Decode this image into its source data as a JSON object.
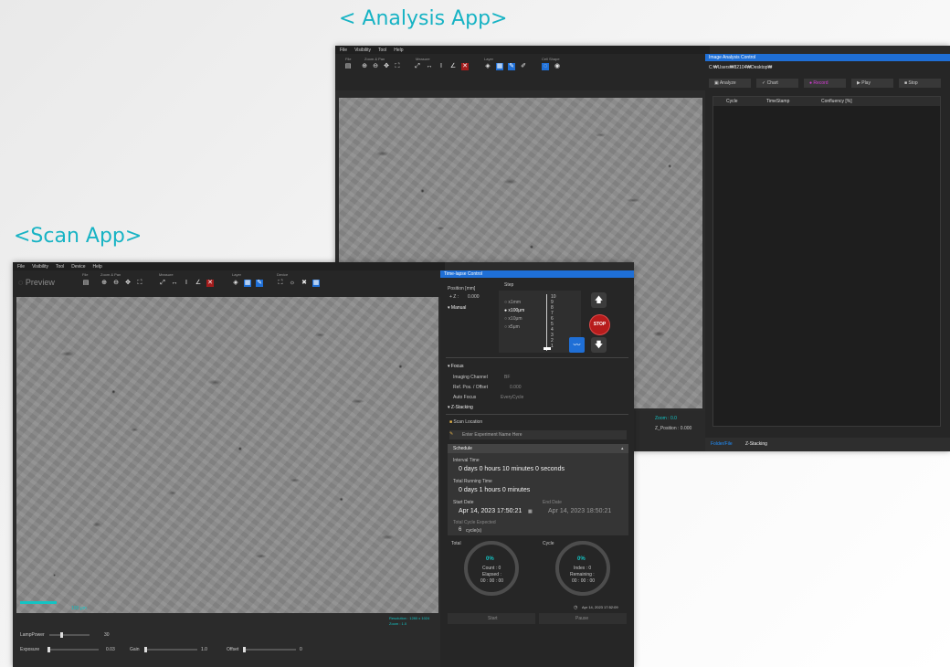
{
  "captions": {
    "analysis": "< Analysis App>",
    "scan": "<Scan App>"
  },
  "colors": {
    "accent": "#1f6fd6",
    "caption": "#17b3c4",
    "progress": "#13c3c3",
    "stop": "#b71c1c"
  },
  "analysis_app": {
    "menu": [
      "File",
      "Visibility",
      "Tool",
      "Help"
    ],
    "toolbar_groups": [
      "File",
      "Zoom & Pan",
      "Measure",
      "Layer",
      "Cell Shape"
    ],
    "panel": {
      "title": "Image Analysis Control",
      "path": "C:₩Users₩82104₩Desktop₩",
      "buttons": [
        "Analyze",
        "Chart",
        "Record",
        "Play",
        "Stop"
      ],
      "columns": [
        "Cycle",
        "TimeStamp",
        "Confluency [%]"
      ],
      "bottom_tabs": [
        "Folder/File",
        "Z-Stacking"
      ]
    },
    "status": {
      "z_position": "Z_Position : 0.000",
      "zoom": "Zoom : 0.0"
    }
  },
  "scan_app": {
    "menu": [
      "File",
      "Visibility",
      "Tool",
      "Device",
      "Help"
    ],
    "preview_label": "Preview",
    "toolbar_groups": [
      "File",
      "Zoom & Pan",
      "Measure",
      "Layer",
      "Device"
    ],
    "viewer": {
      "resolution": "Resolution : 1280 x 1024",
      "zoom": "Zoom : 1.0",
      "scale": "100 μm"
    },
    "controls": {
      "lamp_power_label": "LampPower",
      "lamp_power_value": "30",
      "exposure_label": "Exposure",
      "exposure_value": "0.03",
      "gain_label": "Gain",
      "gain_value": "1.0",
      "offset_label": "Offset",
      "offset_value": "0"
    },
    "timelapse": {
      "title": "Time-lapse Control",
      "position_label": "Position [mm]",
      "z_label": "+ Z :",
      "z_value": "0.000",
      "manual_label": "Manual",
      "step_label": "Step",
      "step_options": [
        "x1mm",
        "x100μm",
        "x10μm",
        "x5μm"
      ],
      "step_selected": 1,
      "scale_numbers": [
        "10",
        "9",
        "8",
        "7",
        "6",
        "5",
        "4",
        "3",
        "2",
        "1"
      ],
      "stop_label": "STOP",
      "focus_label": "Focus",
      "imaging_channel_label": "Imaging Channel",
      "imaging_channel_value": "BF",
      "ref_pos_label": "Ref. Pos. / Offset",
      "ref_pos_value": "0.000",
      "auto_focus_label": "Auto Focus",
      "auto_focus_value": "EveryCycle",
      "zstacking_label": "Z-Stacking",
      "scan_location_label": "Scan Location",
      "experiment_placeholder": "Enter Experiment Name Here",
      "schedule_label": "Schedule",
      "interval_label": "Interval Time",
      "interval_value": "0 days  0 hours  10 minutes  0 seconds",
      "total_running_label": "Total Running Time",
      "total_running_value": "0 days  1 hours  0 minutes",
      "start_date_label": "Start Date",
      "start_date_value": "Apr 14, 2023 17:50:21",
      "end_date_label": "End Date",
      "end_date_value": "Apr 14, 2023 18:50:21",
      "total_cycle_label": "Total Cycle Expected",
      "total_cycle_value": "6",
      "total_cycle_unit": "cycle(s)",
      "total_label": "Total",
      "total_percent": "0%",
      "total_count": "Count : 0",
      "total_elapsed_label": "Elapsed :",
      "total_elapsed": "00 : 00 : 00",
      "cycle_label": "Cycle",
      "cycle_percent": "0%",
      "cycle_index": "Index : 0",
      "cycle_remaining_label": "Remaining :",
      "cycle_remaining": "00 : 00 : 00",
      "timestamp": "Apr 14, 2023 17:52:09",
      "start_button": "Start",
      "pause_button": "Pause",
      "total_progress": 0,
      "cycle_progress": 0
    }
  }
}
